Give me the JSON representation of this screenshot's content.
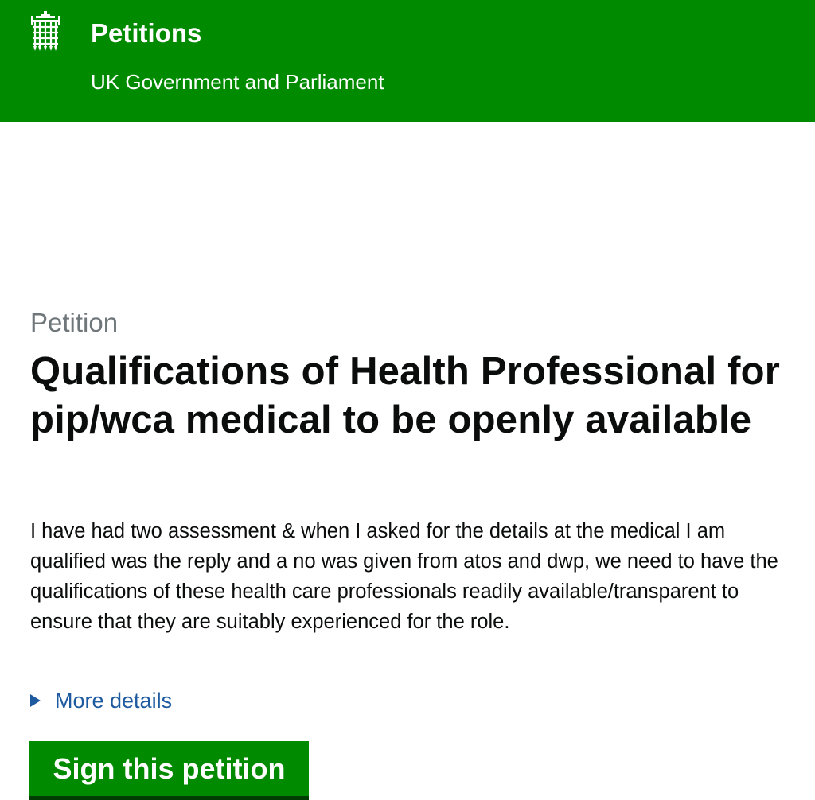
{
  "header": {
    "logo_icon": "portcullis-icon",
    "title": "Petitions",
    "subtitle": "UK Government and Parliament",
    "background_color": "#008a00"
  },
  "petition": {
    "kicker": "Petition",
    "title": "Qualifications of Health Professional for pip/wca medical to be openly available",
    "description": "I have had two assessment & when I asked for the details at the medical I am qualified was the reply and a no was given from atos and dwp, we need to have the qualifications of these health care professionals readily available/transparent to ensure that they are suitably experienced for the role.",
    "more_details_label": "More details",
    "more_details_icon": "triangle-right-icon",
    "sign_button_label": "Sign this petition"
  },
  "colors": {
    "brand_green": "#008a00",
    "link_blue": "#1d5aa0",
    "muted_text": "#6f777b"
  }
}
